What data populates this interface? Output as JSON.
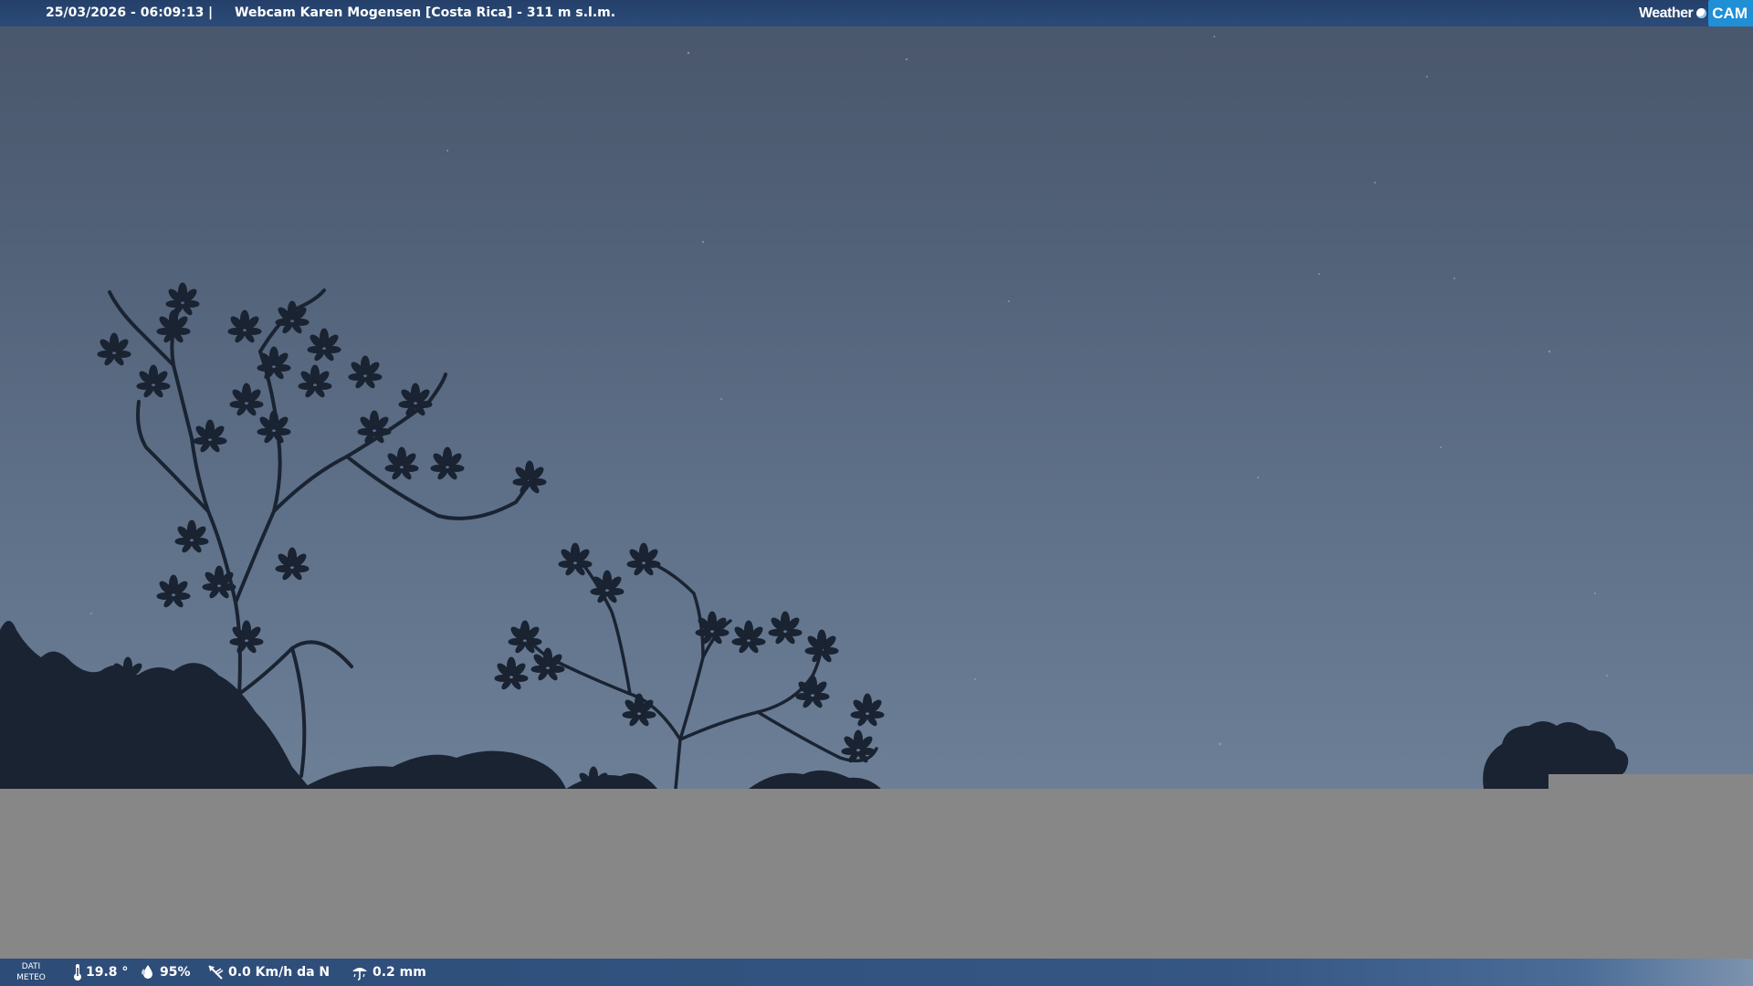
{
  "header": {
    "timestamp": "25/03/2026 - 06:09:13",
    "separator": "|",
    "title": "Webcam Karen Mogensen [Costa Rica]  - 311 m s.l.m.",
    "brand_weather": "Weather",
    "brand_cam": "CAM"
  },
  "weather": {
    "label_line1": "DATI",
    "label_line2": "METEO",
    "temperature": "19.8 °",
    "humidity": "95%",
    "wind": "0.0 Km/h da N",
    "rain": "0.2 mm"
  },
  "icons": {
    "temperature": "thermometer-icon",
    "humidity": "humidity-drops-icon",
    "wind": "wind-vane-icon",
    "rain": "rain-gauge-icon",
    "brand": "weathercam-logo-icon"
  },
  "colors": {
    "bar": "#2c4b78",
    "sky_top": "#49566b",
    "sky_bottom": "#6c7f96",
    "panel": "#878787",
    "brand_accent": "#1f8fd6"
  }
}
